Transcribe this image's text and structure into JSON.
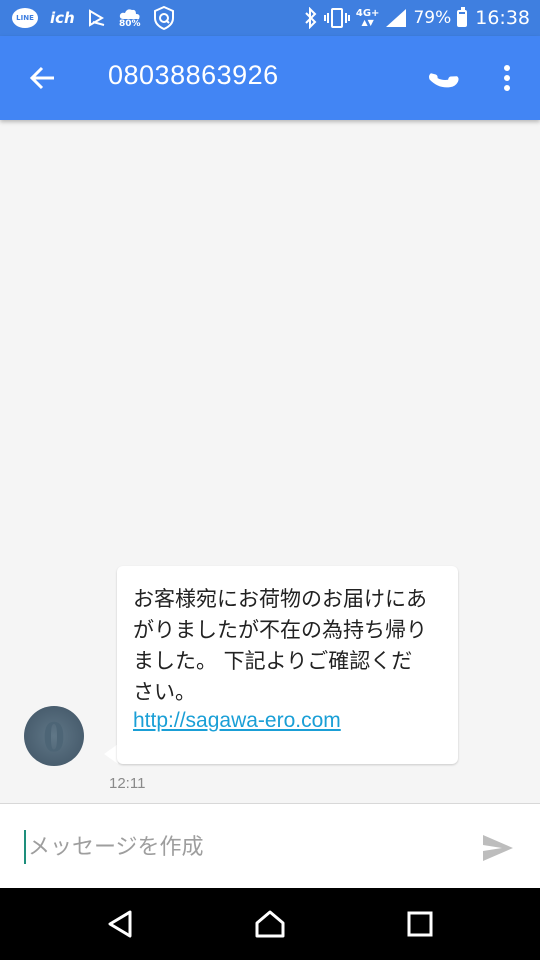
{
  "status_bar": {
    "line_label": "LINE",
    "ich_label": "ich",
    "data_saver_pct": "80%",
    "network": "4G+",
    "battery_pct": "79%",
    "battery_level": 0.79,
    "time": "16:38",
    "icons": [
      "line-icon",
      "ich-icon",
      "play-icon",
      "cloud-icon",
      "shield-icon",
      "bluetooth-icon",
      "vibrate-icon",
      "signal-icon",
      "battery-icon"
    ]
  },
  "toolbar": {
    "title": "08038863926",
    "icons": [
      "back-arrow-icon",
      "phone-icon",
      "more-vert-icon"
    ],
    "color": "#4285f4"
  },
  "conversation": {
    "avatar_letter": "0",
    "message": {
      "text": "お客様宛にお荷物のお届けにあがりましたが不在の為持ち帰りました。 下記よりご確認ください。",
      "link": "http://sagawa-ero.com",
      "time": "12:11"
    }
  },
  "compose": {
    "placeholder": "メッセージを作成",
    "icon": "send-icon"
  },
  "nav_bar": {
    "icons": [
      "back-triangle-icon",
      "home-icon",
      "recents-icon"
    ]
  }
}
